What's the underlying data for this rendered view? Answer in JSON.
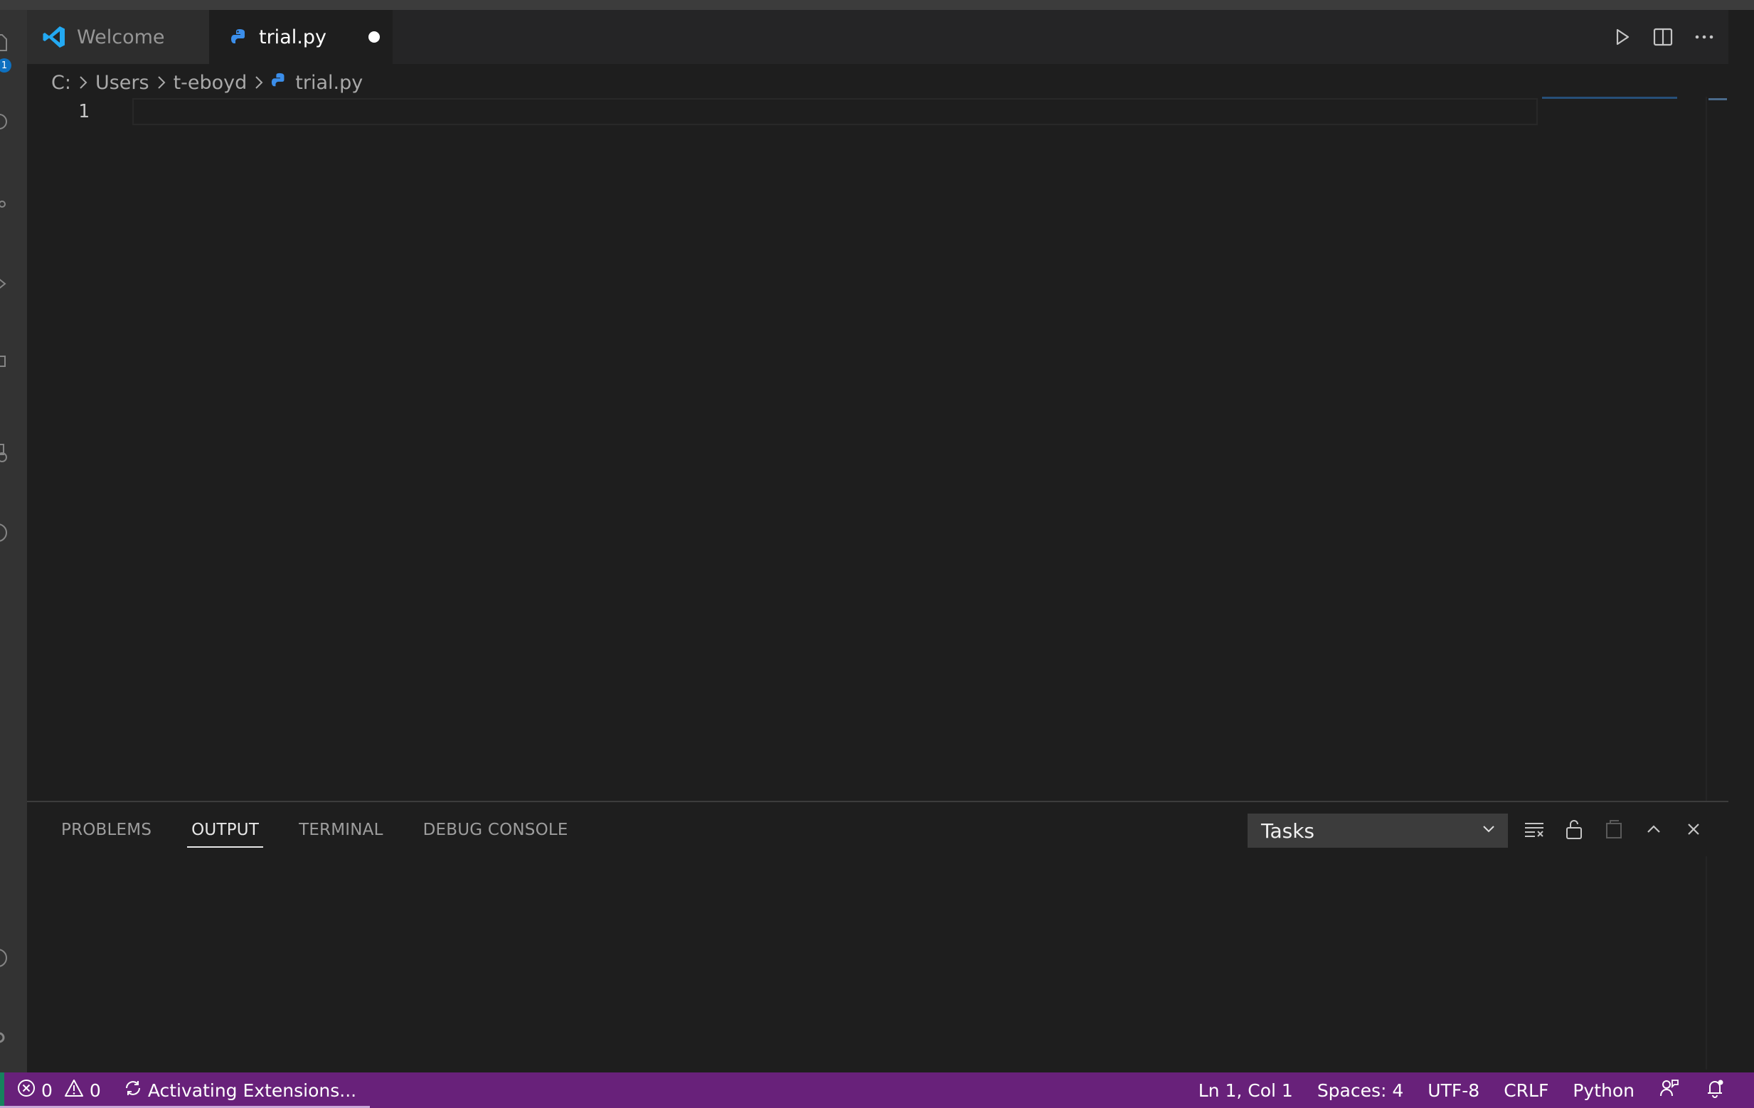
{
  "tabs": [
    {
      "label": "Welcome",
      "icon": "vscode-logo-icon",
      "active": false
    },
    {
      "label": "trial.py",
      "icon": "python-file-icon",
      "active": true,
      "dirty": true
    }
  ],
  "activity_bar": {
    "badge": "1",
    "icons": [
      "explorer-icon",
      "search-icon",
      "source-control-icon",
      "run-debug-icon",
      "extensions-icon",
      "remote-explorer-icon",
      "testing-icon",
      "account-icon",
      "settings-gear-icon"
    ]
  },
  "editor_actions": [
    "run-icon",
    "split-editor-icon",
    "more-actions-icon"
  ],
  "breadcrumb": {
    "items": [
      "C:",
      "Users",
      "t-eboyd"
    ],
    "file": "trial.py"
  },
  "editor": {
    "line_number": "1",
    "content": ""
  },
  "panel": {
    "tabs": [
      "PROBLEMS",
      "OUTPUT",
      "TERMINAL",
      "DEBUG CONSOLE"
    ],
    "active_tab": "OUTPUT",
    "output_channel": "Tasks",
    "actions": [
      "clear-output-icon",
      "lock-scroll-icon",
      "open-in-editor-icon",
      "maximize-panel-icon",
      "close-panel-icon"
    ]
  },
  "status_bar": {
    "errors": "0",
    "warnings": "0",
    "activity": "Activating Extensions...",
    "position": "Ln 1, Col 1",
    "spaces": "Spaces: 4",
    "encoding": "UTF-8",
    "eol": "CRLF",
    "language": "Python",
    "background_color": "#68217a"
  },
  "colors": {
    "editor_bg": "#1e1e1e",
    "tabbar_bg": "#252526",
    "python_icon": "#3b8eea",
    "vscode_logo": "#23a9f2"
  }
}
